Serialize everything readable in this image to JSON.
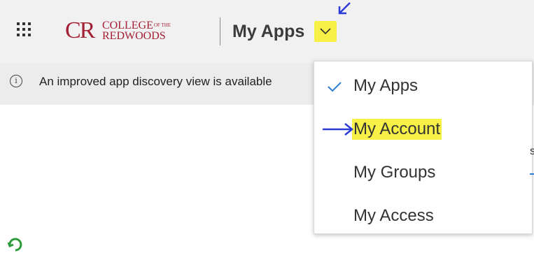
{
  "header": {
    "logo": {
      "monogram": "CR",
      "line1": "COLLEGE",
      "line1_small": "OF THE",
      "line2": "REDWOODS"
    },
    "app_title": "My Apps"
  },
  "banner": {
    "text": "An improved app discovery view is available"
  },
  "dropdown": {
    "items": [
      {
        "label": "My Apps",
        "selected": true
      },
      {
        "label": "My Account",
        "highlighted": true
      },
      {
        "label": "My Groups"
      },
      {
        "label": "My Access"
      }
    ]
  },
  "edge": {
    "letter": "s"
  },
  "colors": {
    "brand": "#a32035",
    "highlight": "#f7f046",
    "annotation_arrow": "#2b3bd6",
    "check": "#2b7cd3",
    "spinner": "#2e9b3a"
  },
  "icons": {
    "waffle": "app-launcher-icon",
    "chevron": "chevron-down-icon",
    "info": "info-icon",
    "check": "checkmark-icon",
    "spinner": "refresh-icon"
  }
}
